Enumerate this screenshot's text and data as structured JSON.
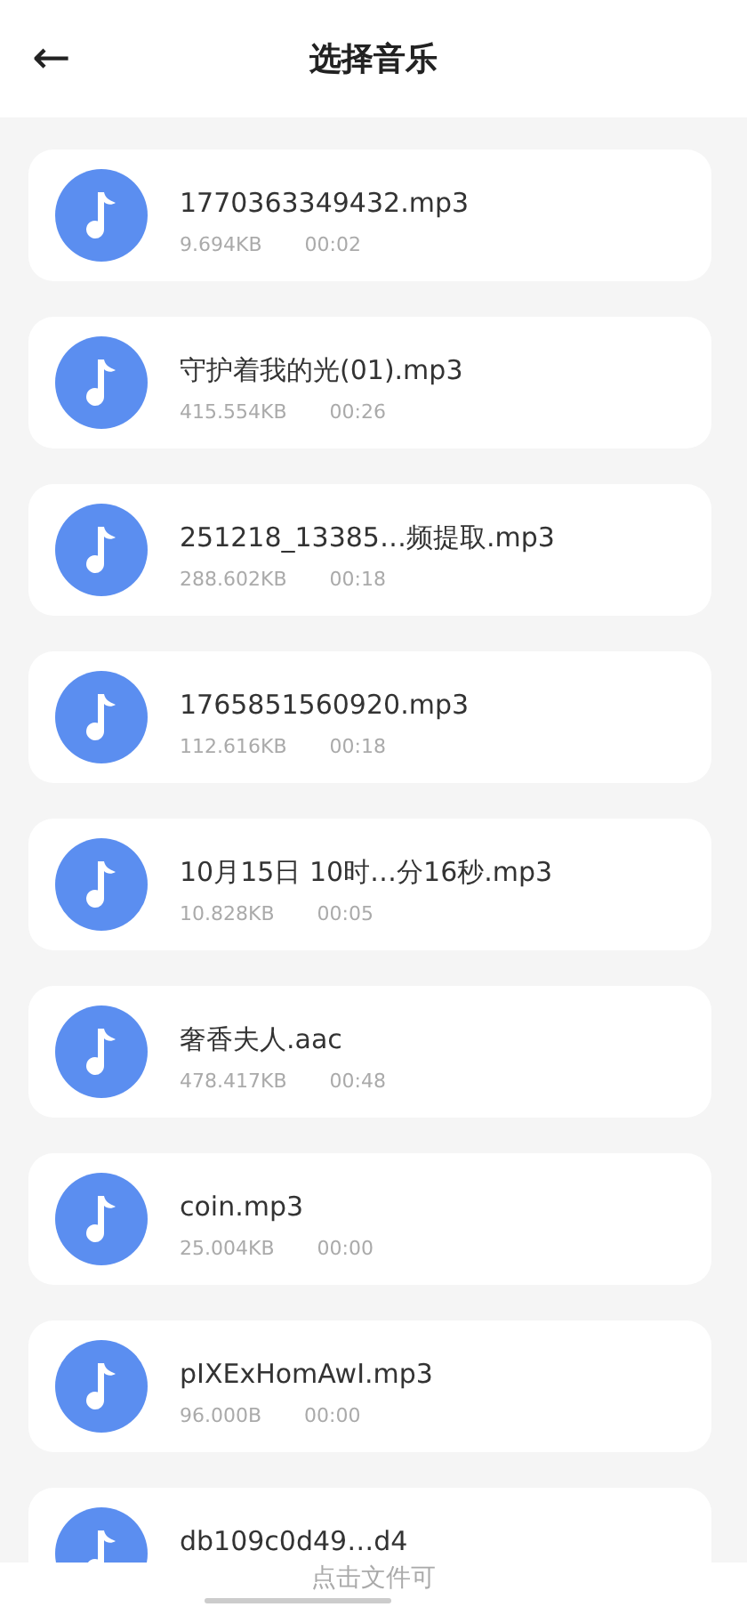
{
  "header": {
    "back": "←",
    "title": "选择音乐"
  },
  "files": [
    {
      "name": "1770363349432.mp3",
      "size": "9.694KB",
      "duration": "00:02"
    },
    {
      "name": "守护着我的光(01).mp3",
      "size": "415.554KB",
      "duration": "00:26"
    },
    {
      "name": "251218_13385…频提取.mp3",
      "size": "288.602KB",
      "duration": "00:18"
    },
    {
      "name": "1765851560920.mp3",
      "size": "112.616KB",
      "duration": "00:18"
    },
    {
      "name": "10月15日 10时…分16秒.mp3",
      "size": "10.828KB",
      "duration": "00:05"
    },
    {
      "name": "奢香夫人.aac",
      "size": "478.417KB",
      "duration": "00:48"
    },
    {
      "name": "coin.mp3",
      "size": "25.004KB",
      "duration": "00:00"
    },
    {
      "name": "pIXExHomAwI.mp3",
      "size": "96.000B",
      "duration": "00:00"
    },
    {
      "name": "db109c0d49…d4"
    }
  ],
  "hint": "点击文件可"
}
